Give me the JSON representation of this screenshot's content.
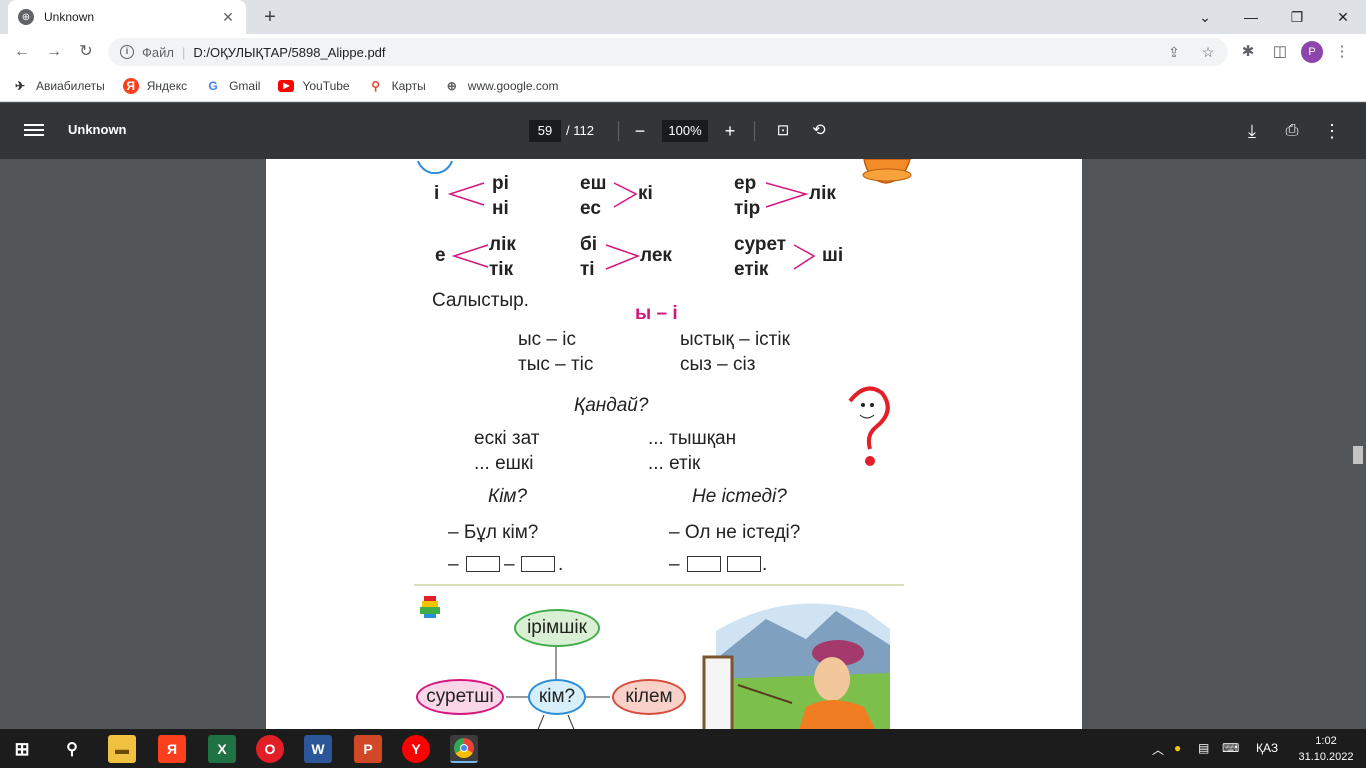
{
  "browser": {
    "tab_title": "Unknown",
    "address_scheme": "Файл",
    "address_url": "D:/ОҚУЛЫҚТАР/5898_Alippe.pdf",
    "avatar_letter": "P",
    "bookmarks": [
      {
        "label": "Авиабилеты",
        "icon": "plane-icon"
      },
      {
        "label": "Яндекс",
        "icon": "yandex-icon"
      },
      {
        "label": "Gmail",
        "icon": "google-icon"
      },
      {
        "label": "YouTube",
        "icon": "youtube-icon"
      },
      {
        "label": "Карты",
        "icon": "maps-icon"
      },
      {
        "label": "www.google.com",
        "icon": "globe-icon"
      }
    ]
  },
  "pdf": {
    "title": "Unknown",
    "current_page": "59",
    "total_pages": "/ 112",
    "zoom": "100%"
  },
  "content": {
    "row1": {
      "a_left": "і",
      "a_top": "рі",
      "a_bottom": "ні",
      "b_top": "еш",
      "b_bottom": "ес",
      "b_right": "кі",
      "c_top": "ер",
      "c_bottom": "тір",
      "c_right": "лік"
    },
    "row2": {
      "a_left": "е",
      "a_top": "лік",
      "a_bottom": "тік",
      "b_top": "бі",
      "b_bottom": "ті",
      "b_right": "лек",
      "c_top": "сурет",
      "c_bottom": "етік",
      "c_right": "ші"
    },
    "compare_label": "Салыстыр.",
    "compare_heading": "ы – і",
    "compare_words": [
      "ыс – іс",
      "ыстық – істік",
      "тыс – тіс",
      "сыз – сіз"
    ],
    "qandai_heading": "Қандай?",
    "qandai_words": [
      "ескі зат",
      "... тышқан",
      "... ешкі",
      "... етік"
    ],
    "kim_heading": "Кім?",
    "ne_istedi_heading": "Не істеді?",
    "kim_question": "– Бұл кім?",
    "ne_question": "– Ол не істеді?",
    "dash": "–",
    "period": ".",
    "bubbles": {
      "top": "ірімшік",
      "center": "кім?",
      "left": "суретші",
      "right": "кілем"
    }
  },
  "taskbar": {
    "language": "ҚАЗ",
    "time": "1:02",
    "date": "31.10.2022"
  },
  "colors": {
    "pink_accent": "#d6167f",
    "pdf_toolbar": "#323639",
    "viewer_bg": "#525659"
  }
}
